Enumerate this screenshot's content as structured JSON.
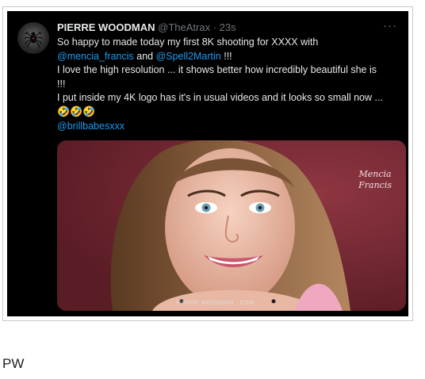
{
  "tweet": {
    "author_name": "PIERRE WOODMAN",
    "handle": "@TheAtrax",
    "separator": "·",
    "time": "23s",
    "more_icon": "more-horizontal-icon",
    "line1": "So happy to made today my first 8K shooting for XXXX with",
    "mention1": "@mencia_francis",
    "line2_mid": " and ",
    "mention2": "@Spell2Martin",
    "line2_end": " !!!",
    "line3": "I love the high resolution ... it shows better how incredibly beautiful she is",
    "line4": "!!!",
    "line5": "I put inside my 4K logo has it's in usual videos and it looks so small now ...",
    "emojis": "🤣🤣🤣",
    "mention3": "@brillbabesxxx"
  },
  "media": {
    "watermark_line1": "Mencia",
    "watermark_line2": "Francis",
    "logo_text": "PIERRE WOODMAN . COM"
  },
  "caption": "PW",
  "colors": {
    "tweet_background": "#000000",
    "link": "#1d9bf0",
    "text": "#e7e9ea",
    "muted": "#71767b"
  }
}
